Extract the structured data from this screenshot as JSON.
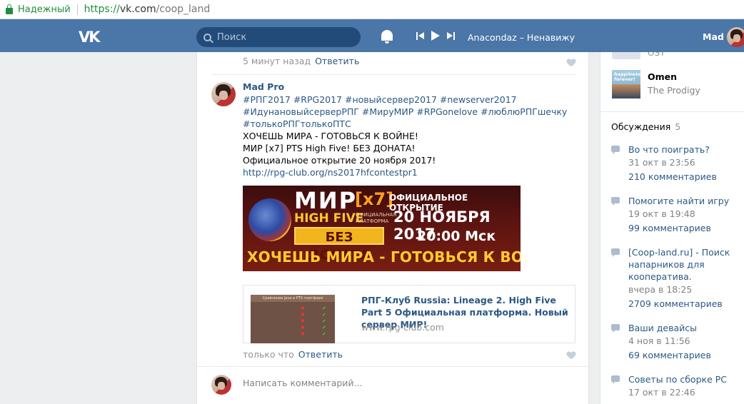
{
  "browser": {
    "secure_label": "Надежный",
    "url_scheme": "https://",
    "url_host": "vk.com",
    "url_path": "/coop_land"
  },
  "header": {
    "logo": "VK",
    "search_placeholder": "Поиск",
    "now_playing": "Anacondaz – Ненавижу",
    "user_name": "Mad"
  },
  "feed": {
    "previous_comment": {
      "time": "5 минут назад",
      "reply": "Ответить"
    },
    "post": {
      "author": "Mad Pro",
      "hashtags_line1": "#РПГ2017 #RPG2017 #новыйсервер2017 #newserver2017",
      "hashtags_line2": "#ИдунановыйсерверРПГ #МируМИР #RPGonelove #люблюРПГшечку",
      "hashtags_line3": "#толькоРПГтолькоПТС",
      "text_line1": "ХОЧЕШЬ МИРА - ГОТОВЬСЯ К ВОЙНЕ!",
      "text_line2": "МИР [x7] PTS High Five! БЕЗ ДОНАТА!",
      "text_line3": "Официальное открытие 20 ноября 2017!",
      "link_url": "http://rpg-club.org/ns2017hfcontestpr1",
      "banner": {
        "mir": "МИР",
        "x7": "[x7]",
        "high_five": "HIGH FIVE",
        "platform": "ОФИЦИАЛЬНАЯ ПЛАТФОРМА",
        "no_donate": "БЕЗ ДОНАТА",
        "official_open": "ОФИЦИАЛЬНОЕ ОТКРЫТИЕ",
        "date": "20 НОЯБРЯ 2017",
        "time": "20:00 Мск",
        "slogan": "ХОЧЕШЬ МИРА - ГОТОВЬСЯ К ВОЙНЕ"
      },
      "link_preview": {
        "thumb_title": "Сравнение Java и PTS платформ",
        "title": "РПГ-Клуб Russia: Lineage 2. High Five Part 5 Официальная платформа. Новый сервер МИР!",
        "domain": "www.rpg-club.com"
      },
      "time": "только что",
      "reply": "Ответить"
    },
    "comment_placeholder": "Написать комментарий..."
  },
  "sidebar": {
    "prev_item_text": "OST",
    "audio": {
      "album_text": "happiness forever!",
      "title": "Omen",
      "artist": "The Prodigy"
    },
    "discussions": {
      "label": "Обсуждения",
      "count": "5",
      "topics": [
        {
          "title": "Во что поиграть?",
          "date": "31 окт в 23:56",
          "comments": "210 комментариев"
        },
        {
          "title": "Помогите найти игру",
          "date": "19 окт в 19:48",
          "comments": "99 комментариев"
        },
        {
          "title": "[Coop-land.ru] - Поиск напарников для кооператива.",
          "date": "вчера в 18:25",
          "comments": "2709 комментариев"
        },
        {
          "title": "Ваши девайсы",
          "date": "4 ноя в 11:56",
          "comments": "69 комментариев"
        },
        {
          "title": "Советы по сборке PC",
          "date": "17 окт в 22:46",
          "comments": ""
        }
      ]
    }
  },
  "colors": {
    "vk_header": "#4a76a8",
    "link": "#2a5885",
    "secure_green": "#1e8e3e",
    "page_bg": "#edeef0"
  }
}
